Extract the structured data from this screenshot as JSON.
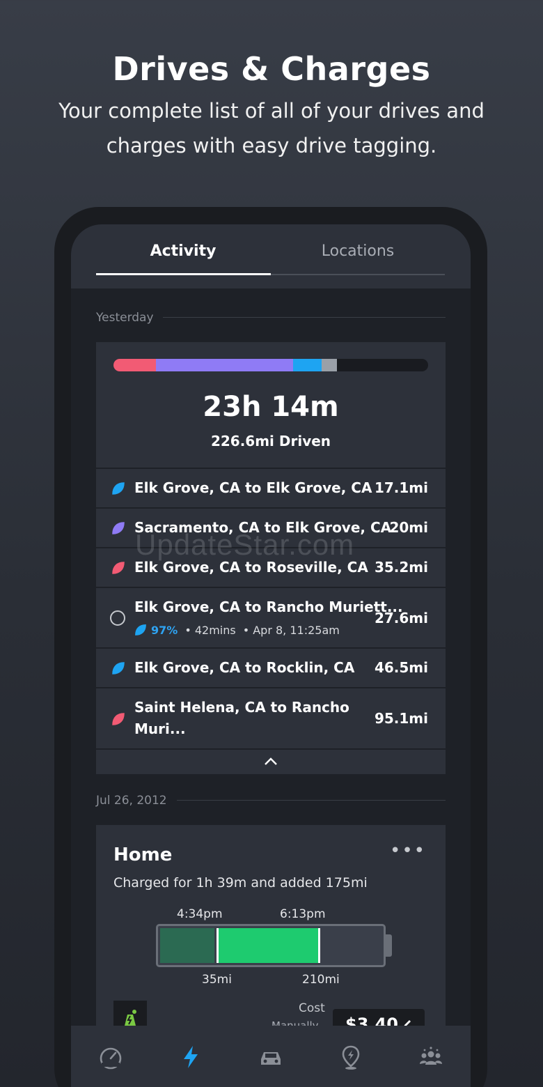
{
  "hero": {
    "title": "Drives & Charges",
    "subtitle": "Your complete list of all of your drives and charges with easy drive tagging."
  },
  "tabs": [
    {
      "label": "Activity",
      "active": true
    },
    {
      "label": "Locations",
      "active": false
    }
  ],
  "sections": {
    "yesterday": "Yesterday",
    "date2": "Jul 26, 2012"
  },
  "summary": {
    "total_time": "23h 14m",
    "total_distance": "226.6mi Driven",
    "segments": [
      {
        "color": "#f25b74",
        "fraction": 0.135
      },
      {
        "color": "#8f7bf5",
        "fraction": 0.435
      },
      {
        "color": "#1ea4f2",
        "fraction": 0.09
      },
      {
        "color": "#9aa0a8",
        "fraction": 0.048
      }
    ]
  },
  "drives": [
    {
      "title": "Elk Grove, CA to Elk Grove, CA",
      "distance": "17.1mi",
      "icon": "leaf-icon",
      "color": "#1ea4f2"
    },
    {
      "title": "Sacramento, CA to Elk Grove, CA",
      "distance": "20mi",
      "icon": "leaf-icon",
      "color": "#8f7bf5"
    },
    {
      "title": "Elk Grove, CA to Roseville, CA",
      "distance": "35.2mi",
      "icon": "leaf-icon",
      "color": "#f25b74"
    },
    {
      "title": "Elk Grove, CA to Rancho Muriett...",
      "distance": "27.6mi",
      "icon": "radio-icon",
      "color": "#c4c7cc",
      "meta": {
        "percent": "97%",
        "duration": "42mins",
        "date": "Apr 8, 11:25am",
        "separator": "•"
      }
    },
    {
      "title": "Elk Grove, CA to Rocklin, CA",
      "distance": "46.5mi",
      "icon": "leaf-icon",
      "color": "#1ea4f2"
    },
    {
      "title_line1": "Saint Helena, CA to Rancho",
      "title_line2": "Muri...",
      "distance": "95.1mi",
      "icon": "leaf-icon",
      "color": "#f25b74"
    }
  ],
  "watermark": "UpdateStar.com",
  "charge": {
    "title": "Home",
    "more": "•••",
    "description": "Charged for 1h 39m and added 175mi",
    "start_time": "4:34pm",
    "end_time": "6:13pm",
    "start_range": "35mi",
    "end_range": "210mi",
    "start_level": 0.25,
    "end_level": 0.72,
    "cost_label": "Cost",
    "cost_sub": "Manually",
    "cost_value": "$3.40",
    "colors": {
      "existing": "#2b6a52",
      "added": "#1ecb6f"
    }
  },
  "bottom_nav": [
    {
      "icon": "speedometer-icon",
      "active": false
    },
    {
      "icon": "lightning-icon",
      "active": true
    },
    {
      "icon": "car-icon",
      "active": false
    },
    {
      "icon": "location-pin-icon",
      "active": false
    },
    {
      "icon": "community-icon",
      "active": false
    }
  ],
  "colors": {
    "accent": "#1ea4f2",
    "background": "#1e2127",
    "card": "#2d313a"
  }
}
